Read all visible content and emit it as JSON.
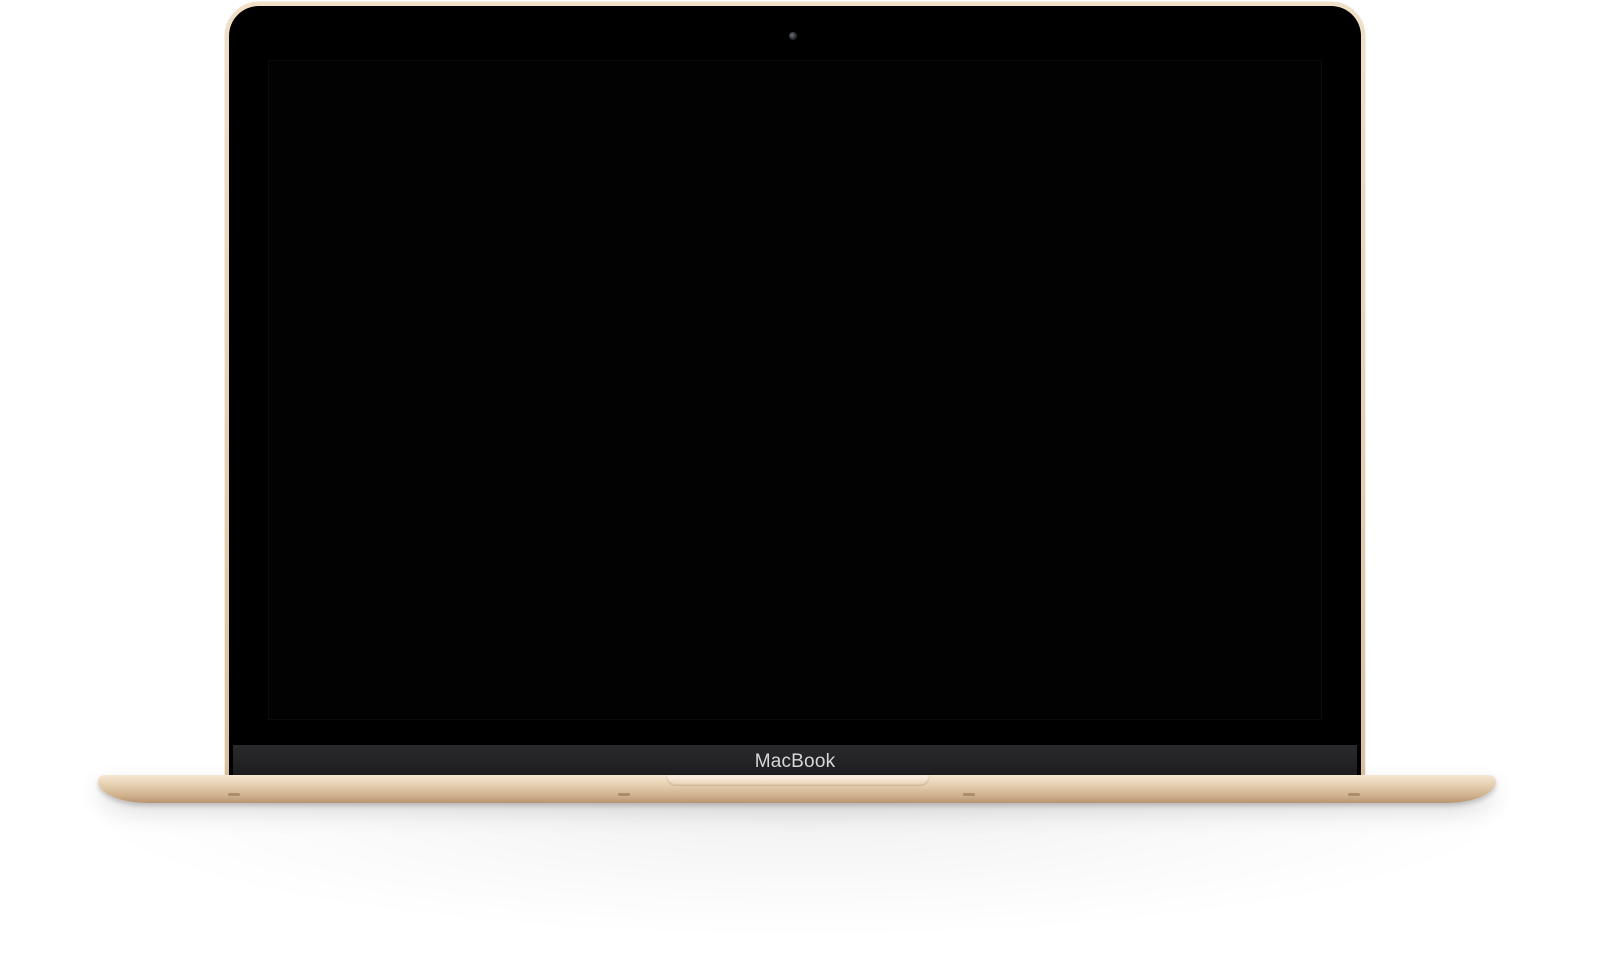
{
  "device": {
    "brand_label": "MacBook"
  },
  "colors": {
    "frame": "#e8d2b4",
    "bezel": "#000000",
    "chin": "#1d1d1f",
    "background": "#ffffff"
  },
  "icons": {
    "camera": "camera-icon"
  }
}
